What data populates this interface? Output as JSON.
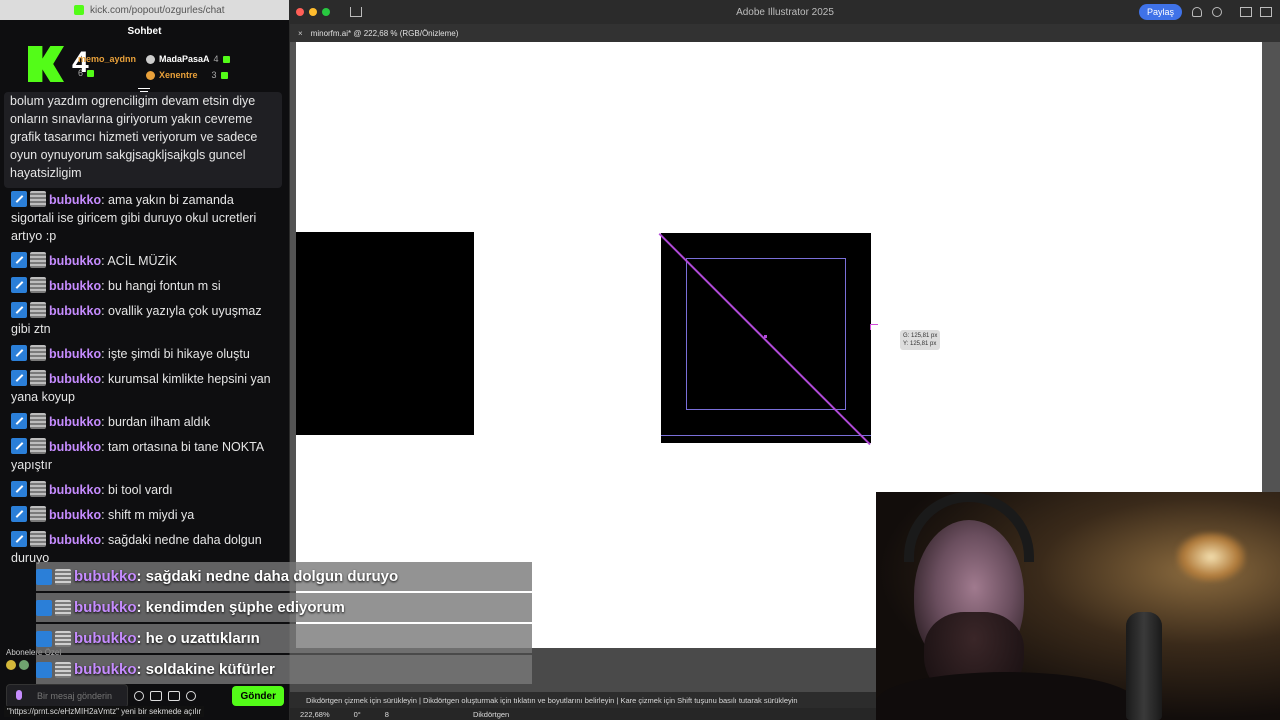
{
  "chat": {
    "url": "kick.com/popout/ozgurles/chat",
    "title": "Sohbet",
    "brand_number": "4",
    "leaderboard": [
      {
        "name": "memo_aydnn",
        "count": "6"
      },
      {
        "name": "MadaPasaA",
        "count": "4"
      },
      {
        "name": "Xenentre",
        "count": "3"
      }
    ],
    "highlighted_text": "bolum yazdım ogrenciligim devam etsin diye onların sınavlarına giriyorum yakın cevreme grafik tasarımcı hizmeti veriyorum ve sadece oyun oynuyorum sakgjsagkljsajkgls guncel hayatsizligim",
    "messages": [
      {
        "user": "bubukko",
        "text": ": ama yakın bi zamanda sigortali ise giricem gibi duruyo okul ucretleri artıyo :p"
      },
      {
        "user": "bubukko",
        "text": ": ACİL MÜZİK"
      },
      {
        "user": "bubukko",
        "text": ": bu hangi fontun m si"
      },
      {
        "user": "bubukko",
        "text": ": ovallik yazıyla çok uyuşmaz gibi ztn"
      },
      {
        "user": "bubukko",
        "text": ": işte şimdi bi hikaye oluştu"
      },
      {
        "user": "bubukko",
        "text": ": kurumsal kimlikte hepsini yan yana koyup"
      },
      {
        "user": "bubukko",
        "text": ": burdan ilham aldık"
      },
      {
        "user": "bubukko",
        "text": ": tam ortasına bi tane NOKTA yapıştır"
      },
      {
        "user": "bubukko",
        "text": ": bi tool vardı"
      },
      {
        "user": "bubukko",
        "text": ": shift m miydi ya"
      },
      {
        "user": "bubukko",
        "text": ": sağdaki nedne daha dolgun duruyo"
      },
      {
        "user": "bubukko",
        "text": ": kendimden şüphe ediyorum"
      },
      {
        "user": "bubukko",
        "text": ": he o uzattıkların"
      },
      {
        "user": "bubukko",
        "text": ": soldakine küfürler"
      }
    ],
    "sub_only_label": "Abonelere Özel",
    "input_placeholder": "Bir mesaj gönderin",
    "send_label": "Gönder",
    "link_hint": "\"https://prnt.sc/eHzMIH2aVmtz\" yeni bir sekmede açılır"
  },
  "illustrator": {
    "app_title": "Adobe Illustrator 2025",
    "share_label": "Paylaş",
    "tab_label": "minorfm.ai* @ 222,68 % (RGB/Önizleme)",
    "cursor_label_g": "G: 125,81 px",
    "cursor_label_y": "Y: 125,81 px",
    "status_text": "Dikdörtgen çizmek için sürükleyin | Dikdörtgen oluşturmak için tıklatın ve boyutlarını belirleyin | Kare çizmek için Shift tuşunu basılı tutarak sürükleyin",
    "zoom": "222,68%",
    "rotation": "0°",
    "artboard_num": "8",
    "tool_name": "Dikdörtgen"
  },
  "overlay": [
    {
      "user": "bubukko",
      "text": ": sağdaki nedne daha dolgun duruyo"
    },
    {
      "user": "bubukko",
      "text": ": kendimden şüphe ediyorum"
    },
    {
      "user": "bubukko",
      "text": ": he o uzattıkların"
    },
    {
      "user": "bubukko",
      "text": ": soldakine küfürler"
    }
  ],
  "colors": {
    "kick_green": "#53fc18",
    "username": "#c68cff",
    "selection": "#7a6fd8",
    "path": "#b14ad8",
    "share_blue": "#3f72e8"
  }
}
